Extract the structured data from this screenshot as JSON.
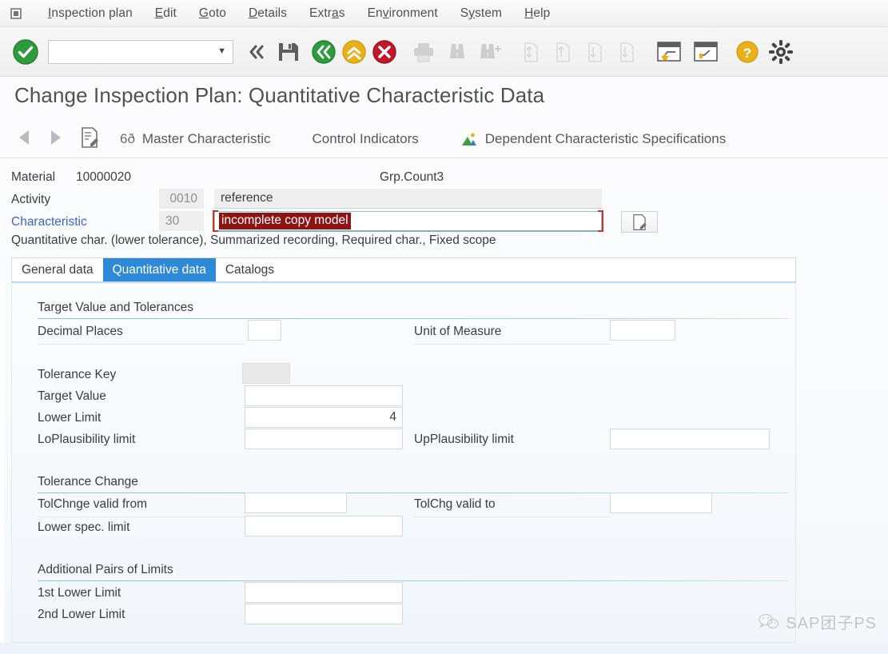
{
  "menubar": {
    "logo_icon": "sap-menu-icon",
    "items": [
      {
        "label": "Inspection plan",
        "accel": "I"
      },
      {
        "label": "Edit",
        "accel": "E"
      },
      {
        "label": "Goto",
        "accel": "G"
      },
      {
        "label": "Details",
        "accel": "D"
      },
      {
        "label": "Extras",
        "accel": "a"
      },
      {
        "label": "Environment",
        "accel": "v"
      },
      {
        "label": "System",
        "accel": "y"
      },
      {
        "label": "Help",
        "accel": "H"
      }
    ]
  },
  "toolbar": {
    "enter_icon": "green-check-icon",
    "command_field_value": "",
    "command_field_placeholder": "",
    "dropdown_icon": "chevron-down-icon",
    "icons": [
      {
        "name": "double-chevron-left-icon",
        "enabled": true
      },
      {
        "name": "save-floppy-icon",
        "enabled": true
      },
      {
        "name": "back-green-icon",
        "enabled": true
      },
      {
        "name": "exit-yellow-up-icon",
        "enabled": true
      },
      {
        "name": "cancel-red-x-icon",
        "enabled": true
      },
      {
        "name": "print-icon",
        "enabled": false
      },
      {
        "name": "find-binoculars-icon",
        "enabled": false
      },
      {
        "name": "find-next-binoculars-icon",
        "enabled": false
      },
      {
        "name": "first-page-icon",
        "enabled": false
      },
      {
        "name": "previous-page-icon",
        "enabled": false
      },
      {
        "name": "next-page-icon",
        "enabled": false
      },
      {
        "name": "last-page-icon",
        "enabled": false
      },
      {
        "name": "create-session-star-icon",
        "enabled": true
      },
      {
        "name": "create-shortcut-icon",
        "enabled": true
      },
      {
        "name": "help-question-icon",
        "enabled": true
      },
      {
        "name": "customize-gear-icon",
        "enabled": true
      }
    ]
  },
  "page": {
    "title": "Change Inspection Plan: Quantitative Characteristic Data"
  },
  "apptoolbar": {
    "prev_icon": "triangle-left-icon",
    "next_icon": "triangle-right-icon",
    "doc_icon": "document-edit-icon",
    "buttons": [
      {
        "label": "Master Characteristic",
        "icon": "glasses-icon",
        "glyph": "6ð"
      },
      {
        "label": "Control Indicators",
        "icon": null,
        "glyph": ""
      },
      {
        "label": "Dependent Characteristic Specifications",
        "icon": "mountain-picture-icon",
        "glyph": ""
      }
    ]
  },
  "header": {
    "material_label": "Material",
    "material_value": "10000020",
    "group_label": "Grp.Count3",
    "activity_label": "Activity",
    "activity_value": "0010",
    "activity_desc": "reference",
    "characteristic_label": "Characteristic",
    "characteristic_value": "30",
    "characteristic_desc_selected": "incomplete copy model",
    "detail_button_icon": "document-edit-icon"
  },
  "description_line": "Quantitative char. (lower tolerance), Summarized recording, Required char., Fixed scope",
  "tabs": [
    {
      "label": "General data",
      "active": false
    },
    {
      "label": "Quantitative data",
      "active": true
    },
    {
      "label": "Catalogs",
      "active": false
    }
  ],
  "sections": [
    {
      "title": "Target Value and Tolerances",
      "fields": [
        {
          "label": "Decimal Places",
          "value": "",
          "col": "left",
          "type": "small"
        },
        {
          "label": "Unit of Measure",
          "value": "",
          "col": "right",
          "type": "small"
        },
        {
          "label": "Tolerance Key",
          "value": "",
          "col": "left",
          "type": "disabled"
        },
        {
          "label": "Target Value",
          "value": "",
          "col": "left",
          "type": "wide"
        },
        {
          "label": "Lower Limit",
          "value": "4",
          "col": "left",
          "type": "wide-num"
        },
        {
          "label": "LoPlausibility limit",
          "value": "",
          "col": "left",
          "type": "wide"
        },
        {
          "label": "UpPlausibility limit",
          "value": "",
          "col": "right",
          "type": "wide"
        }
      ]
    },
    {
      "title": "Tolerance Change",
      "fields": [
        {
          "label": "TolChnge valid from",
          "value": "",
          "col": "left",
          "type": "medium"
        },
        {
          "label": "TolChg valid to",
          "value": "",
          "col": "right",
          "type": "medium"
        },
        {
          "label": "Lower spec. limit",
          "value": "",
          "col": "left",
          "type": "wide"
        }
      ]
    },
    {
      "title": "Additional Pairs of Limits",
      "fields": [
        {
          "label": "1st Lower Limit",
          "value": "",
          "col": "left",
          "type": "wide"
        },
        {
          "label": "2nd Lower Limit",
          "value": "",
          "col": "left",
          "type": "wide"
        }
      ]
    }
  ],
  "watermark": {
    "icon": "wechat-logo-icon",
    "text": "SAP团子PS"
  },
  "colors": {
    "accent_blue": "#2e8ad6",
    "error_red": "#8e1414",
    "focus_red": "#c0392b",
    "link_blue": "#3a64c8",
    "rule_teal": "#8fc2d4",
    "green": "#2e9b3f",
    "yellow": "#e8b11c"
  }
}
